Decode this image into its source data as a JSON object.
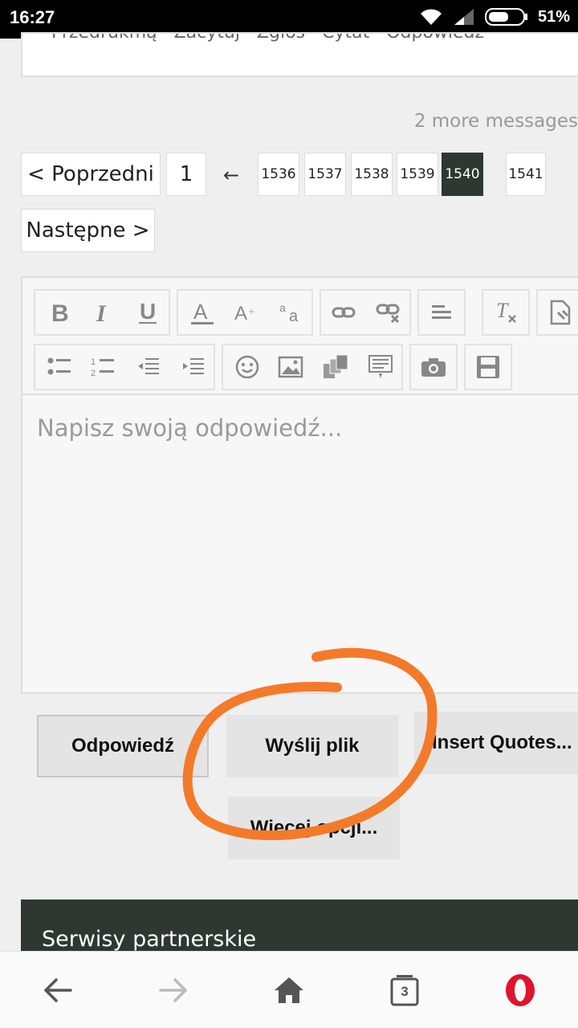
{
  "status_bar": {
    "time": "16:27",
    "battery": "51%"
  },
  "top_card": {
    "text": "Przedrukmą · Zacytuj · Zgłoś · Cytat · Odpowiedź"
  },
  "thread": {
    "more_messages": "2 more messages"
  },
  "pagination": {
    "prev_label": "< Poprzedni",
    "first_page": "1",
    "arrow": "←",
    "pages": [
      "1536",
      "1537",
      "1538",
      "1539",
      "1540",
      "1541"
    ],
    "current_page": "1540",
    "next_label": "Następne >"
  },
  "editor": {
    "placeholder": "Napisz swoją odpowiedź...",
    "toolbar_icons": [
      "bold-icon",
      "italic-icon",
      "underline-icon",
      "font-color-icon",
      "font-size-icon",
      "font-style-icon",
      "link-icon",
      "unlink-icon",
      "align-icon",
      "clear-format-icon",
      "source-icon",
      "bullet-list-icon",
      "numbered-list-icon",
      "outdent-icon",
      "indent-icon",
      "emoji-icon",
      "image-icon",
      "media-icon",
      "template-icon",
      "camera-icon",
      "save-icon"
    ]
  },
  "actions": {
    "reply_label": "Odpowiedź",
    "upload_label": "Wyślij plik",
    "quotes_label": "Insert Quotes...",
    "more_label": "Więcej opcji..."
  },
  "footer": {
    "title": "Serwisy partnerskie"
  },
  "bottom_nav": {
    "tabs_count": "3"
  },
  "colors": {
    "accent_dark": "#2d3830",
    "annotation": "#f47a2a",
    "opera_red": "#e0142b"
  }
}
